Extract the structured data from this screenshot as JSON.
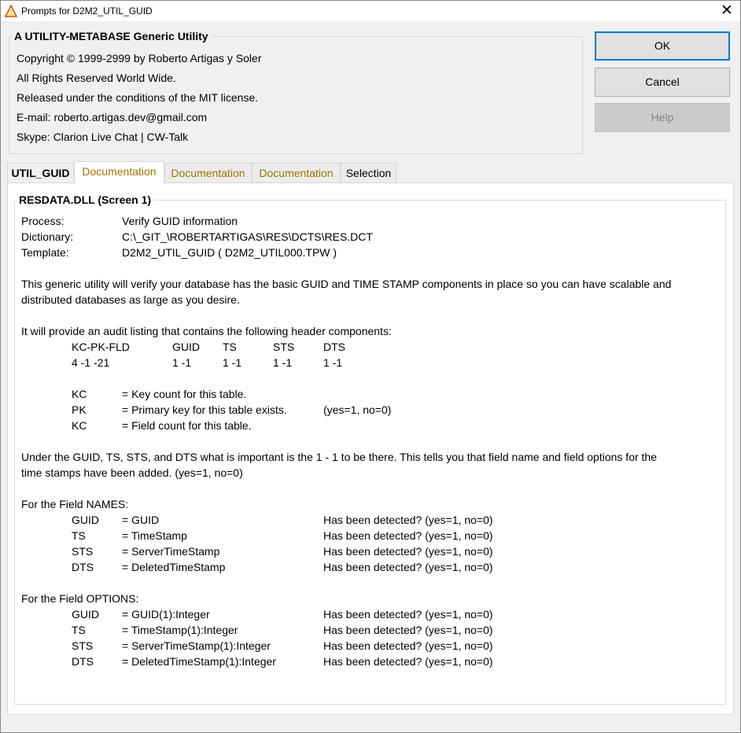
{
  "window": {
    "title": "Prompts for D2M2_UTIL_GUID",
    "close_glyph": "✕",
    "app_icon": "warning-triangle-icon"
  },
  "header_group": {
    "title": "A UTILITY-METABASE Generic Utility",
    "lines": [
      "Copyright © 1999-2999 by Roberto Artigas y Soler",
      "All Rights Reserved World Wide.",
      "Released under the conditions of the MIT license.",
      "E-mail: roberto.artigas.dev@gmail.com",
      "Skype: Clarion Live Chat | CW-Talk"
    ]
  },
  "buttons": {
    "ok": "OK",
    "cancel": "Cancel",
    "help": "Help"
  },
  "tabs": [
    "UTIL_GUID",
    "Documentation",
    "Documentation",
    "Documentation",
    "Selection"
  ],
  "active_tab_index": 1,
  "doc": {
    "box_title": "RESDATA.DLL (Screen 1)",
    "meta": [
      {
        "label": "Process:",
        "value": "Verify GUID information"
      },
      {
        "label": "Dictionary:",
        "value": "C:\\_GIT_\\ROBERTARTIGAS\\RES\\DCTS\\RES.DCT"
      },
      {
        "label": "Template:",
        "value": "D2M2_UTIL_GUID ( D2M2_UTIL000.TPW )"
      }
    ],
    "intro_lines": [
      "This generic utility will verify your database has the basic GUID and TIME STAMP components in place so you can have scalable and",
      "distributed databases as large as you desire."
    ],
    "audit_intro": "It will provide an audit listing that contains the following header components:",
    "audit_header": [
      "KC-PK-FLD",
      "GUID",
      "TS",
      "STS",
      "DTS"
    ],
    "audit_values": [
      "4 -1 -21",
      "1 -1",
      "1 -1",
      "1 -1",
      "1 -1"
    ],
    "legend": [
      {
        "key": "KC",
        "desc": "= Key count for this table.",
        "note": ""
      },
      {
        "key": "PK",
        "desc": "= Primary key for this table exists.",
        "note": "(yes=1, no=0)"
      },
      {
        "key": "KC",
        "desc": "= Field count for this table.",
        "note": ""
      }
    ],
    "guid_lines": [
      "Under the GUID, TS, STS, and DTS what is important is the 1 - 1 to be there. This tells you that field name and field options for the",
      "time stamps have been added. (yes=1, no=0)"
    ],
    "names_title": "For the Field NAMES:",
    "names": [
      {
        "key": "GUID",
        "desc": "= GUID",
        "detected": "Has been detected? (yes=1, no=0)"
      },
      {
        "key": "TS",
        "desc": "= TimeStamp",
        "detected": "Has been detected? (yes=1, no=0)"
      },
      {
        "key": "STS",
        "desc": "= ServerTimeStamp",
        "detected": "Has been detected? (yes=1, no=0)"
      },
      {
        "key": "DTS",
        "desc": "= DeletedTimeStamp",
        "detected": "Has been detected? (yes=1, no=0)"
      }
    ],
    "options_title": "For the Field OPTIONS:",
    "options": [
      {
        "key": "GUID",
        "desc": "= GUID(1):Integer",
        "detected": "Has been detected? (yes=1, no=0)"
      },
      {
        "key": "TS",
        "desc": "= TimeStamp(1):Integer",
        "detected": "Has been detected? (yes=1, no=0)"
      },
      {
        "key": "STS",
        "desc": "= ServerTimeStamp(1):Integer",
        "detected": "Has been detected? (yes=1, no=0)"
      },
      {
        "key": "DTS",
        "desc": "= DeletedTimeStamp(1):Integer",
        "detected": "Has been detected? (yes=1, no=0)"
      }
    ]
  },
  "colors": {
    "accent": "#0078d7",
    "doc_tab_text": "#a07400",
    "window_bg": "#f0f0f0"
  }
}
